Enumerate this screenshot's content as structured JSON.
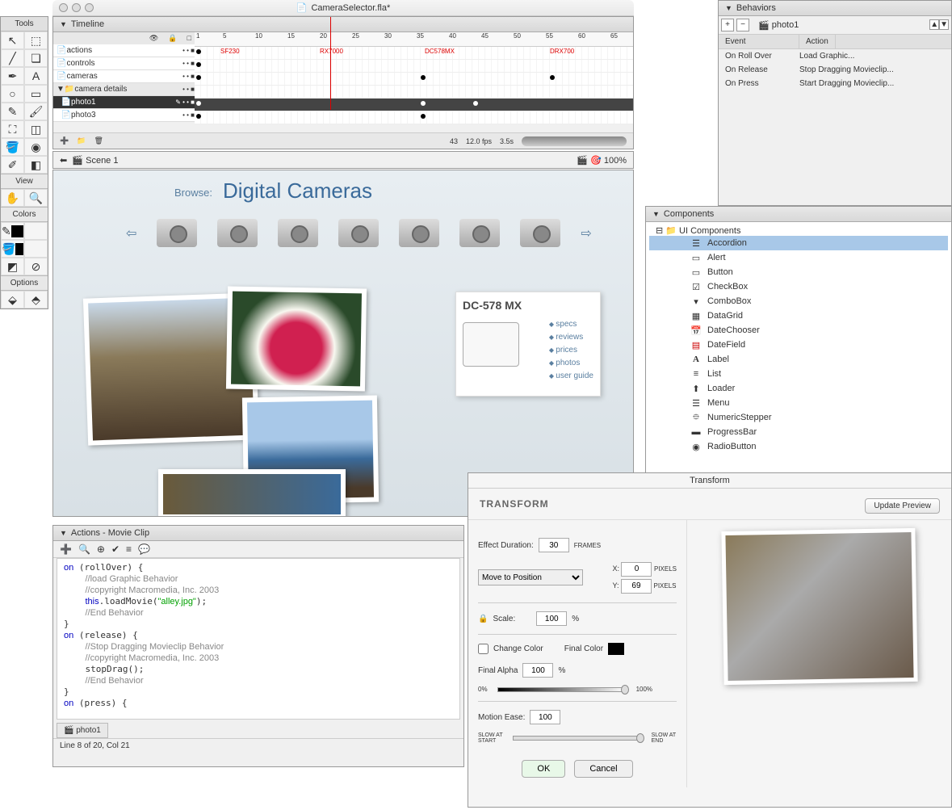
{
  "window": {
    "title": "CameraSelector.fla*"
  },
  "tools": {
    "title": "Tools",
    "view_label": "View",
    "colors_label": "Colors",
    "options_label": "Options"
  },
  "timeline": {
    "title": "Timeline",
    "layers": [
      "actions",
      "controls",
      "cameras",
      "camera details",
      "photo1",
      "photo3"
    ],
    "ruler_marks": [
      "1",
      "5",
      "10",
      "15",
      "20",
      "25",
      "30",
      "35",
      "40",
      "45",
      "50",
      "55",
      "60",
      "65"
    ],
    "keyframe_labels": [
      "SF230",
      "RX7000",
      "DC578MX",
      "DRX700"
    ],
    "footer": {
      "frame": "43",
      "fps": "12.0 fps",
      "time": "3.5s"
    }
  },
  "scene": {
    "name": "Scene 1",
    "zoom": "100%"
  },
  "stage": {
    "browse_label": "Browse:",
    "browse_title": "Digital Cameras",
    "detail": {
      "title": "DC-578 MX",
      "links": [
        "specs",
        "reviews",
        "prices",
        "photos",
        "user guide"
      ]
    }
  },
  "behaviors": {
    "title": "Behaviors",
    "target": "photo1",
    "cols": [
      "Event",
      "Action"
    ],
    "rows": [
      {
        "event": "On Roll Over",
        "action": "Load Graphic..."
      },
      {
        "event": "On Release",
        "action": "Stop Dragging Movieclip..."
      },
      {
        "event": "On Press",
        "action": "Start Dragging Movieclip..."
      }
    ]
  },
  "components": {
    "title": "Components",
    "root": "UI Components",
    "items": [
      "Accordion",
      "Alert",
      "Button",
      "CheckBox",
      "ComboBox",
      "DataGrid",
      "DateChooser",
      "DateField",
      "Label",
      "List",
      "Loader",
      "Menu",
      "NumericStepper",
      "ProgressBar",
      "RadioButton"
    ]
  },
  "actions": {
    "title": "Actions - Movie Clip",
    "tab": "photo1",
    "status": "Line 8 of 20, Col 21",
    "code": "on (rollOver) {\n    //load Graphic Behavior\n    //copyright Macromedia, Inc. 2003\n    this.loadMovie(\"alley.jpg\");\n    //End Behavior\n}\non (release) {\n    //Stop Dragging Movieclip Behavior\n    //copyright Macromedia, Inc. 2003\n    stopDrag();\n    //End Behavior\n}\non (press) {"
  },
  "transform": {
    "tab": "Transform",
    "title": "TRANSFORM",
    "update": "Update Preview",
    "duration_label": "Effect Duration:",
    "duration": "30",
    "frames": "FRAMES",
    "move": "Move to Position",
    "x_label": "X:",
    "x": "0",
    "y_label": "Y:",
    "y": "69",
    "pixels": "PIXELS",
    "scale_label": "Scale:",
    "scale": "100",
    "percent": "%",
    "change_color": "Change Color",
    "final_color": "Final Color",
    "final_alpha_label": "Final Alpha",
    "final_alpha": "100",
    "slider_min": "0%",
    "slider_max": "100%",
    "ease_label": "Motion Ease:",
    "ease": "100",
    "slow_start": "SLOW AT\nSTART",
    "slow_end": "SLOW AT\nEND",
    "ok": "OK",
    "cancel": "Cancel"
  }
}
